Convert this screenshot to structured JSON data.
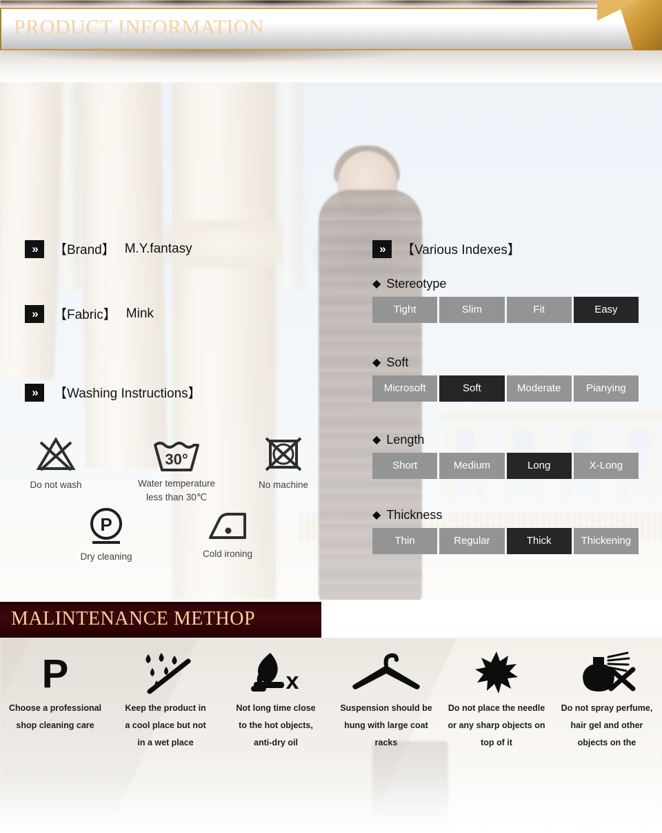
{
  "header": {
    "title": "PRODUCT INFORMATION",
    "gold": "#f2d2a4",
    "maroon": "#4c0a0e",
    "gold_trim": "#c9973f"
  },
  "specs": {
    "brand": {
      "chevron": "»",
      "label": "【Brand】",
      "value": "M.Y.fantasy"
    },
    "fabric": {
      "chevron": "»",
      "label": "【Fabric】",
      "value": "Mink"
    },
    "washing": {
      "chevron": "»",
      "label": "【Washing Instructions】"
    }
  },
  "care_symbols": [
    {
      "icon": "do-not-wash-icon",
      "caption": "Do not wash"
    },
    {
      "icon": "wash-temperature-icon",
      "caption_line1": "Water temperature",
      "caption_line2": "less than 30℃",
      "badge": "30°"
    },
    {
      "icon": "no-machine-icon",
      "caption": "No machine"
    },
    {
      "icon": "dry-cleaning-icon",
      "caption": "Dry cleaning",
      "badge": "P"
    },
    {
      "icon": "cold-ironing-icon",
      "caption": "Cold ironing"
    }
  ],
  "indexes": {
    "chevron": "»",
    "heading": "【Various Indexes】",
    "diamond": "◆",
    "pill_bg": "#949494",
    "pill_selected_bg": "#262626",
    "groups": [
      {
        "title": "Stereotype",
        "options": [
          "Tight",
          "Slim",
          "Fit",
          "Easy"
        ],
        "selected": 3
      },
      {
        "title": "Soft",
        "options": [
          "Microsoft",
          "Soft",
          "Moderate",
          "Pianying"
        ],
        "selected": 1
      },
      {
        "title": "Length",
        "options": [
          "Short",
          "Medium",
          "Long",
          "X-Long"
        ],
        "selected": 2
      },
      {
        "title": "Thickness",
        "options": [
          "Thin",
          "Regular",
          "Thick",
          "Thickening"
        ],
        "selected": 2
      }
    ]
  },
  "maintenance": {
    "title": "MALINTENANCE METHOP",
    "items": [
      {
        "icon": "professional-cleaning-icon",
        "lines": [
          "Choose a professional",
          "shop cleaning care"
        ]
      },
      {
        "icon": "keep-dry-icon",
        "lines": [
          "Keep the product in",
          "a cool place but not",
          "in a wet place"
        ]
      },
      {
        "icon": "no-fire-icon",
        "lines": [
          "Not long time close",
          "to the hot objects,",
          "anti-dry oil"
        ]
      },
      {
        "icon": "hanger-icon",
        "lines": [
          "Suspension should be",
          "hung with large coat",
          "racks"
        ]
      },
      {
        "icon": "no-sharp-objects-icon",
        "lines": [
          "Do not place the needle",
          "or any sharp objects on",
          "top of it"
        ]
      },
      {
        "icon": "no-perfume-icon",
        "lines": [
          "Do not spray perfume,",
          "hair gel and other",
          "objects on the"
        ]
      }
    ]
  }
}
